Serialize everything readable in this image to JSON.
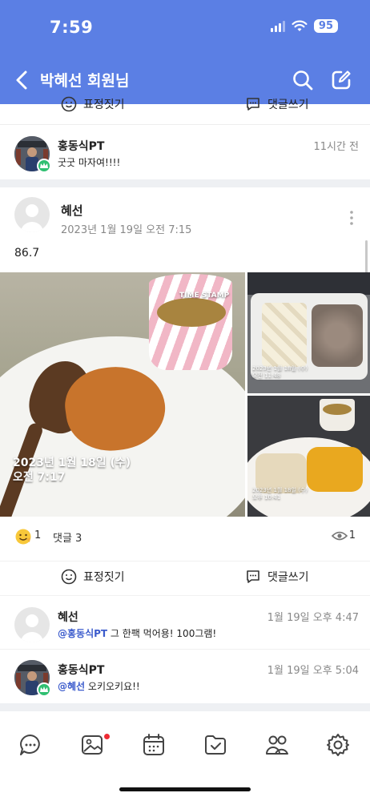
{
  "status": {
    "time": "7:59",
    "battery": "95"
  },
  "header": {
    "title": "박혜선 회원님"
  },
  "top_actions": {
    "react_label": "표정짓기",
    "comment_label": "댓글쓰기"
  },
  "comment_top": {
    "name": "홍동식PT",
    "text": "굿굿 마자여!!!!",
    "time": "11시간 전"
  },
  "post": {
    "author": "혜선",
    "date": "2023년 1월 19일 오전 7:15",
    "body": "86.7",
    "photo_main_stamp": "2023년 1월 18일 (수)\n오전 7:17",
    "photo_main_brand": "TIME STAMP",
    "photo_tr_stamp": "2023년 1월 18일 (수)\n오전 11:48",
    "photo_br_stamp": "2023년 1월 18일 (수)\n오후 10:41",
    "reaction_count": "1",
    "comment_count_label": "댓글 3",
    "view_count": "1",
    "react_label": "표정짓기",
    "comment_label": "댓글쓰기"
  },
  "comments": [
    {
      "name": "혜선",
      "mention": "@홍동식PT",
      "text": " 그 한팩 먹어용! 100그램!",
      "time": "1월 19일 오후 4:47"
    },
    {
      "name": "홍동식PT",
      "mention": "@혜선",
      "text": " 오키오키요!!",
      "time": "1월 19일 오후 5:04"
    }
  ],
  "tabbar": {
    "items": [
      "chat-icon",
      "gallery-icon",
      "calendar-icon",
      "checklist-icon",
      "members-icon",
      "settings-icon"
    ]
  },
  "colors": {
    "header": "#5b7fe4",
    "mention": "#3b5bcc",
    "badge": "#2fbf71",
    "notification": "#ee2b34"
  }
}
